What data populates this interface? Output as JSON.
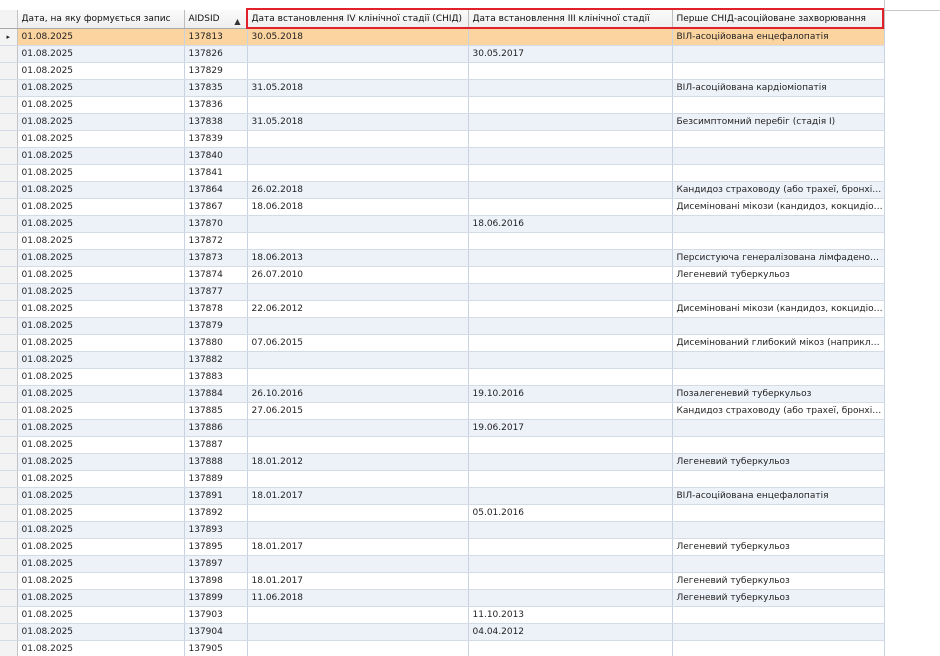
{
  "columns": {
    "date": "Дата, на яку формується запис",
    "aidsid": "AIDSID",
    "stage4": "Дата встановлення  IV клінічної стадії (СНІД)",
    "stage3": "Дата встановлення  III клінічної стадії",
    "first_disease": "Перше СНІД-асоційоване захворювання"
  },
  "sort_indicator": "▲",
  "current_row_indicator": "▸",
  "rows": [
    {
      "date": "01.08.2025",
      "aidsid": "137813",
      "stage4": "30.05.2018",
      "stage3": "",
      "first_disease": "ВІЛ-асоційована енцефалопатія"
    },
    {
      "date": "01.08.2025",
      "aidsid": "137826",
      "stage4": "",
      "stage3": "30.05.2017",
      "first_disease": ""
    },
    {
      "date": "01.08.2025",
      "aidsid": "137829",
      "stage4": "",
      "stage3": "",
      "first_disease": ""
    },
    {
      "date": "01.08.2025",
      "aidsid": "137835",
      "stage4": "31.05.2018",
      "stage3": "",
      "first_disease": "ВІЛ-асоційована кардіоміопатія"
    },
    {
      "date": "01.08.2025",
      "aidsid": "137836",
      "stage4": "",
      "stage3": "",
      "first_disease": ""
    },
    {
      "date": "01.08.2025",
      "aidsid": "137838",
      "stage4": "31.05.2018",
      "stage3": "",
      "first_disease": "Безсимптомний перебіг (стадія І)"
    },
    {
      "date": "01.08.2025",
      "aidsid": "137839",
      "stage4": "",
      "stage3": "",
      "first_disease": ""
    },
    {
      "date": "01.08.2025",
      "aidsid": "137840",
      "stage4": "",
      "stage3": "",
      "first_disease": ""
    },
    {
      "date": "01.08.2025",
      "aidsid": "137841",
      "stage4": "",
      "stage3": "",
      "first_disease": ""
    },
    {
      "date": "01.08.2025",
      "aidsid": "137864",
      "stage4": "26.02.2018",
      "stage3": "",
      "first_disease": "Кандидоз страховоду (або трахеї, бронхів, л..."
    },
    {
      "date": "01.08.2025",
      "aidsid": "137867",
      "stage4": "18.06.2018",
      "stage3": "",
      "first_disease": "Дисеміновані мікози (кандидоз, кокцидіомі..."
    },
    {
      "date": "01.08.2025",
      "aidsid": "137870",
      "stage4": "",
      "stage3": "18.06.2016",
      "first_disease": ""
    },
    {
      "date": "01.08.2025",
      "aidsid": "137872",
      "stage4": "",
      "stage3": "",
      "first_disease": ""
    },
    {
      "date": "01.08.2025",
      "aidsid": "137873",
      "stage4": "18.06.2013",
      "stage3": "",
      "first_disease": "Персистуюча генералізована лімфаденопатія"
    },
    {
      "date": "01.08.2025",
      "aidsid": "137874",
      "stage4": "26.07.2010",
      "stage3": "",
      "first_disease": "Легеневий туберкульоз"
    },
    {
      "date": "01.08.2025",
      "aidsid": "137877",
      "stage4": "",
      "stage3": "",
      "first_disease": ""
    },
    {
      "date": "01.08.2025",
      "aidsid": "137878",
      "stage4": "22.06.2012",
      "stage3": "",
      "first_disease": "Дисеміновані мікози (кандидоз, кокцидіомі..."
    },
    {
      "date": "01.08.2025",
      "aidsid": "137879",
      "stage4": "",
      "stage3": "",
      "first_disease": ""
    },
    {
      "date": "01.08.2025",
      "aidsid": "137880",
      "stage4": "07.06.2015",
      "stage3": "",
      "first_disease": "Дисемінований глибокий мікоз (наприклад:..."
    },
    {
      "date": "01.08.2025",
      "aidsid": "137882",
      "stage4": "",
      "stage3": "",
      "first_disease": ""
    },
    {
      "date": "01.08.2025",
      "aidsid": "137883",
      "stage4": "",
      "stage3": "",
      "first_disease": ""
    },
    {
      "date": "01.08.2025",
      "aidsid": "137884",
      "stage4": "26.10.2016",
      "stage3": "19.10.2016",
      "first_disease": "Позалегеневий туберкульоз"
    },
    {
      "date": "01.08.2025",
      "aidsid": "137885",
      "stage4": "27.06.2015",
      "stage3": "",
      "first_disease": "Кандидоз страховоду (або трахеї, бронхів, л..."
    },
    {
      "date": "01.08.2025",
      "aidsid": "137886",
      "stage4": "",
      "stage3": "19.06.2017",
      "first_disease": ""
    },
    {
      "date": "01.08.2025",
      "aidsid": "137887",
      "stage4": "",
      "stage3": "",
      "first_disease": ""
    },
    {
      "date": "01.08.2025",
      "aidsid": "137888",
      "stage4": "18.01.2012",
      "stage3": "",
      "first_disease": "Легеневий туберкульоз"
    },
    {
      "date": "01.08.2025",
      "aidsid": "137889",
      "stage4": "",
      "stage3": "",
      "first_disease": ""
    },
    {
      "date": "01.08.2025",
      "aidsid": "137891",
      "stage4": "18.01.2017",
      "stage3": "",
      "first_disease": "ВІЛ-асоційована енцефалопатія"
    },
    {
      "date": "01.08.2025",
      "aidsid": "137892",
      "stage4": "",
      "stage3": "05.01.2016",
      "first_disease": ""
    },
    {
      "date": "01.08.2025",
      "aidsid": "137893",
      "stage4": "",
      "stage3": "",
      "first_disease": ""
    },
    {
      "date": "01.08.2025",
      "aidsid": "137895",
      "stage4": "18.01.2017",
      "stage3": "",
      "first_disease": "Легеневий туберкульоз"
    },
    {
      "date": "01.08.2025",
      "aidsid": "137897",
      "stage4": "",
      "stage3": "",
      "first_disease": ""
    },
    {
      "date": "01.08.2025",
      "aidsid": "137898",
      "stage4": "18.01.2017",
      "stage3": "",
      "first_disease": "Легеневий туберкульоз"
    },
    {
      "date": "01.08.2025",
      "aidsid": "137899",
      "stage4": "11.06.2018",
      "stage3": "",
      "first_disease": "Легеневий туберкульоз"
    },
    {
      "date": "01.08.2025",
      "aidsid": "137903",
      "stage4": "",
      "stage3": "11.10.2013",
      "first_disease": ""
    },
    {
      "date": "01.08.2025",
      "aidsid": "137904",
      "stage4": "",
      "stage3": "04.04.2012",
      "first_disease": ""
    },
    {
      "date": "01.08.2025",
      "aidsid": "137905",
      "stage4": "",
      "stage3": "",
      "first_disease": ""
    }
  ],
  "colors": {
    "selected_row": "#fbd4a0",
    "alt_row": "#edf1f8",
    "highlight_border": "#e0202a"
  }
}
